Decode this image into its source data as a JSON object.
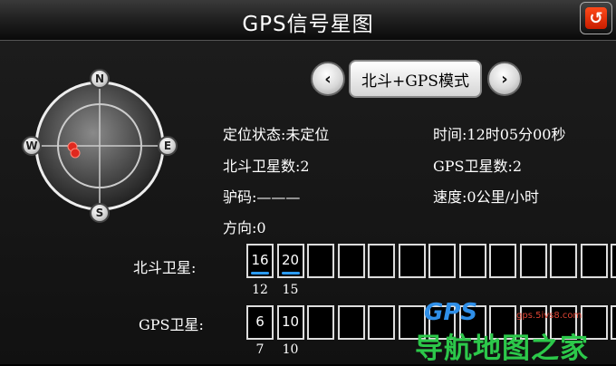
{
  "header": {
    "title": "GPS信号星图",
    "back_icon": "↺"
  },
  "compass": {
    "north": "N",
    "south": "S",
    "west": "W",
    "east": "E"
  },
  "mode": {
    "label": "北斗+GPS模式",
    "prev_icon": "‹",
    "next_icon": "›"
  },
  "status": {
    "fix": "定位状态:未定位",
    "time": "时间:12时05分00秒",
    "beidou_count": "北斗卫星数:2",
    "gps_count": "GPS卫星数:2",
    "altitude": "驴码:———",
    "speed": "速度:0公里/小时",
    "heading": "方向:0"
  },
  "beidou": {
    "label": "北斗卫星:",
    "slots": [
      "16",
      "20",
      "",
      "",
      "",
      "",
      "",
      "",
      "",
      "",
      "",
      "",
      ""
    ],
    "signal": [
      true,
      true,
      false,
      false,
      false,
      false,
      false,
      false,
      false,
      false,
      false,
      false,
      false
    ],
    "ids": [
      "12",
      "15"
    ]
  },
  "gps": {
    "label": "GPS卫星:",
    "slots": [
      "6",
      "10",
      "",
      "",
      "",
      "",
      "",
      "",
      "",
      "",
      "",
      "",
      ""
    ],
    "ids": [
      "7",
      "10"
    ]
  },
  "watermark": {
    "logo": "GPS",
    "url": "gps.5ivs8.com",
    "text": "导航地图之家"
  },
  "colors": {
    "signal_bar": "#2a9bff",
    "satellite_dot": "#e0281e",
    "back_button": "#e63a10"
  }
}
